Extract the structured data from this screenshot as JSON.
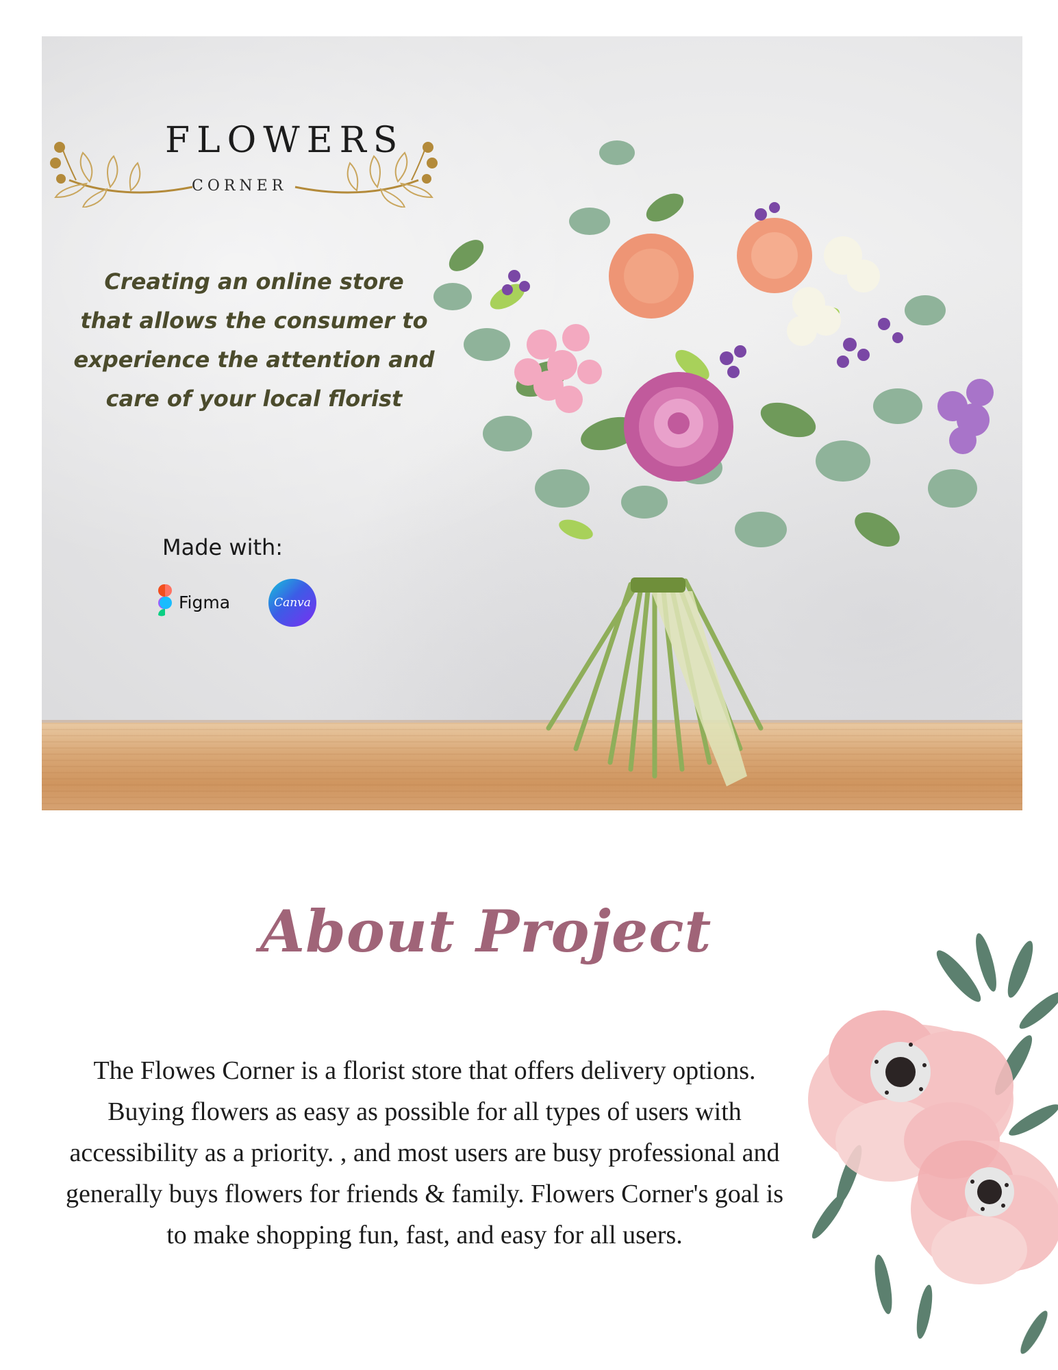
{
  "logo": {
    "title": "FLOWERS",
    "subtitle": "CORNER"
  },
  "hero": {
    "tagline_lines": [
      "Creating an online store",
      "that allows the consumer to",
      "experience the attention and",
      "care of your local florist"
    ],
    "made_with_label": "Made with:",
    "tools": {
      "figma": "Figma",
      "canva": "Canva"
    }
  },
  "about": {
    "title": "About Project",
    "body": "The Flowes Corner is a florist store that offers delivery options. Buying flowers as easy as possible for all types of users with accessibility as a priority. , and most users are busy professional and generally buys flowers for friends & family. Flowers Corner's goal is to make shopping fun, fast, and easy for all users."
  },
  "colors": {
    "logo_gold": "#b38a3a",
    "tagline": "#4b4b2c",
    "about_title": "#a06478"
  },
  "icons": [
    "laurel-icon",
    "figma-icon",
    "canva-icon"
  ]
}
